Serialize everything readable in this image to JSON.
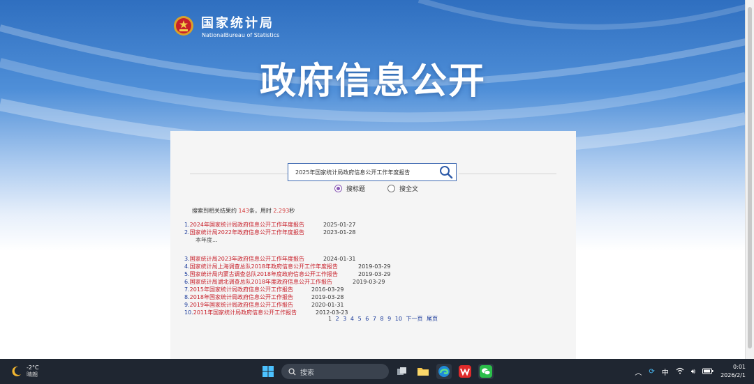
{
  "header": {
    "bureau_cn": "国家统计局",
    "bureau_en": "NationalBureau of Statistics",
    "hero_title": "政府信息公开"
  },
  "search": {
    "query": "2025年国家统计局政府信息公开工作年度报告",
    "options": [
      {
        "label": "搜标题",
        "selected": true
      },
      {
        "label": "搜全文",
        "selected": false
      }
    ],
    "summary": {
      "prefix": "搜索到相关结果约 ",
      "count": "143",
      "mid": "条，用时 ",
      "time": "2.293",
      "suffix": "秒"
    }
  },
  "results": [
    {
      "idx": "1.",
      "title": "2024年国家统计局政府信息公开工作年度报告",
      "date": "2025-01-27"
    },
    {
      "idx": "2.",
      "title": "国家统计局2022年政府信息公开工作年度报告",
      "date": "2023-01-28",
      "snippet": "本年度..."
    },
    {
      "idx": "3.",
      "title": "国家统计局2023年政府信息公开工作年度报告",
      "date": "2024-01-31"
    },
    {
      "idx": "4.",
      "title": "国家统计局上海调查总队2018年政府信息公开工作年度报告",
      "date": "2019-03-29"
    },
    {
      "idx": "5.",
      "title": "国家统计局内蒙古调查总队2018年度政府信息公开工作报告",
      "date": "2019-03-29"
    },
    {
      "idx": "6.",
      "title": "国家统计局湖北调查总队2018年度政府信息公开工作报告",
      "date": "2019-03-29"
    },
    {
      "idx": "7.",
      "title": "2015年国家统计局政府信息公开工作报告",
      "date": "2016-03-29"
    },
    {
      "idx": "8.",
      "title": "2018年国家统计局政府信息公开工作报告",
      "date": "2019-03-28"
    },
    {
      "idx": "9.",
      "title": "2019年国家统计局政府信息公开工作报告",
      "date": "2020-01-31"
    },
    {
      "idx": "10.",
      "title": "2011年国家统计局政府信息公开工作报告",
      "date": "2012-03-23"
    }
  ],
  "pager": {
    "pages": [
      "1",
      "2",
      "3",
      "4",
      "5",
      "6",
      "7",
      "8",
      "9",
      "10"
    ],
    "current": "1",
    "next": "下一页",
    "last": "尾页"
  },
  "taskbar": {
    "temperature": "-2°C",
    "condition": "晴朗",
    "search_label": "搜索",
    "ime": "中",
    "time": "0:01",
    "date": "2026/2/1"
  },
  "colors": {
    "link_red": "#c8202a",
    "link_blue": "#1a3a9a",
    "accent_purple": "#8a5ab5"
  },
  "icons": [
    "national-emblem-icon",
    "search-icon",
    "windows-start-icon",
    "task-view-icon",
    "file-explorer-icon",
    "edge-icon",
    "wps-icon",
    "wechat-icon",
    "moon-weather-icon"
  ]
}
